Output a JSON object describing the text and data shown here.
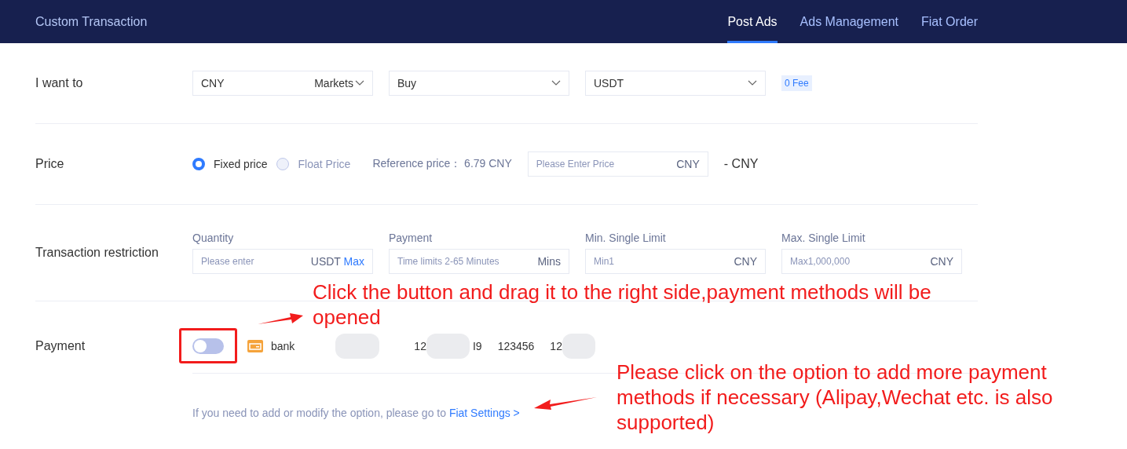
{
  "header": {
    "title": "Custom Transaction",
    "tabs": [
      {
        "label": "Post Ads",
        "selected": true
      },
      {
        "label": "Ads Management",
        "selected": false
      },
      {
        "label": "Fiat Order",
        "selected": false
      }
    ]
  },
  "want": {
    "label": "I want to",
    "fields": [
      {
        "value": "CNY",
        "suffix": "Markets"
      },
      {
        "value": "Buy"
      },
      {
        "value": "USDT"
      }
    ],
    "badge": "0 Fee"
  },
  "price": {
    "label": "Price",
    "options": [
      {
        "label": "Fixed price",
        "selected": true
      },
      {
        "label": "Float Price",
        "selected": false
      }
    ],
    "reference_label": "Reference price：",
    "reference_value": "6.79 CNY",
    "input": {
      "placeholder": "Please Enter Price",
      "unit": "CNY"
    },
    "result": "- CNY"
  },
  "restriction": {
    "label": "Transaction restriction",
    "fields": [
      {
        "title": "Quantity",
        "placeholder": "Please enter",
        "unit": "USDT",
        "action": "Max"
      },
      {
        "title": "Payment",
        "placeholder": "Time limits 2-65 Minutes",
        "unit": "Mins"
      },
      {
        "title": "Min. Single Limit",
        "placeholder": "Min1",
        "unit": "CNY"
      },
      {
        "title": "Max. Single Limit",
        "placeholder": "Max1,000,000",
        "unit": "CNY"
      }
    ]
  },
  "payment": {
    "label": "Payment",
    "toggle_on": false,
    "method": "bank",
    "details": [
      "12",
      "I9",
      "123456",
      "12"
    ]
  },
  "hint": {
    "text": "If you need to add or modify the option, please go to",
    "link": "Fiat Settings >"
  },
  "annotations": [
    "Click the button and drag it to the right side,payment methods will be opened",
    "Please click on the option to add more payment methods if necessary (Alipay,Wechat etc. is also supported)"
  ]
}
